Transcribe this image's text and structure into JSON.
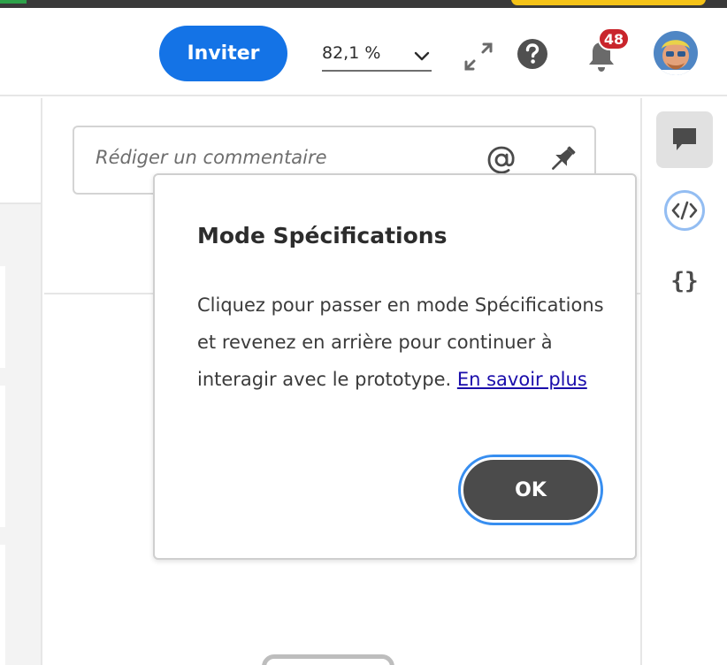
{
  "header": {
    "invite_label": "Inviter",
    "zoom": {
      "value": "82,1 %"
    },
    "notifications_count": "48",
    "icons": {
      "expand": "expand-icon",
      "help": "help-icon",
      "notifications": "bell-icon",
      "avatar": "avatar"
    }
  },
  "comment": {
    "placeholder": "Rédiger un commentaire",
    "mention_icon": "at-icon",
    "pin_icon": "pin-icon"
  },
  "rail": {
    "items": [
      {
        "icon": "comment-icon",
        "label": "",
        "active": true
      },
      {
        "icon": "code-icon",
        "label": "</>",
        "focused": true
      },
      {
        "icon": "braces-icon",
        "label": "{}"
      }
    ]
  },
  "popover": {
    "title": "Mode Spécifications",
    "body": "Cliquez pour passer en mode Spécifications et revenez en arrière pour continuer à interagir avec le prototype.",
    "link_label": "En savoir plus",
    "ok_label": "OK"
  },
  "colors": {
    "accent": "#1473e6",
    "badge": "#c9252c",
    "ok_button": "#4b4b4b",
    "focus_ring": "#378ef0",
    "link": "#1a0dab"
  }
}
